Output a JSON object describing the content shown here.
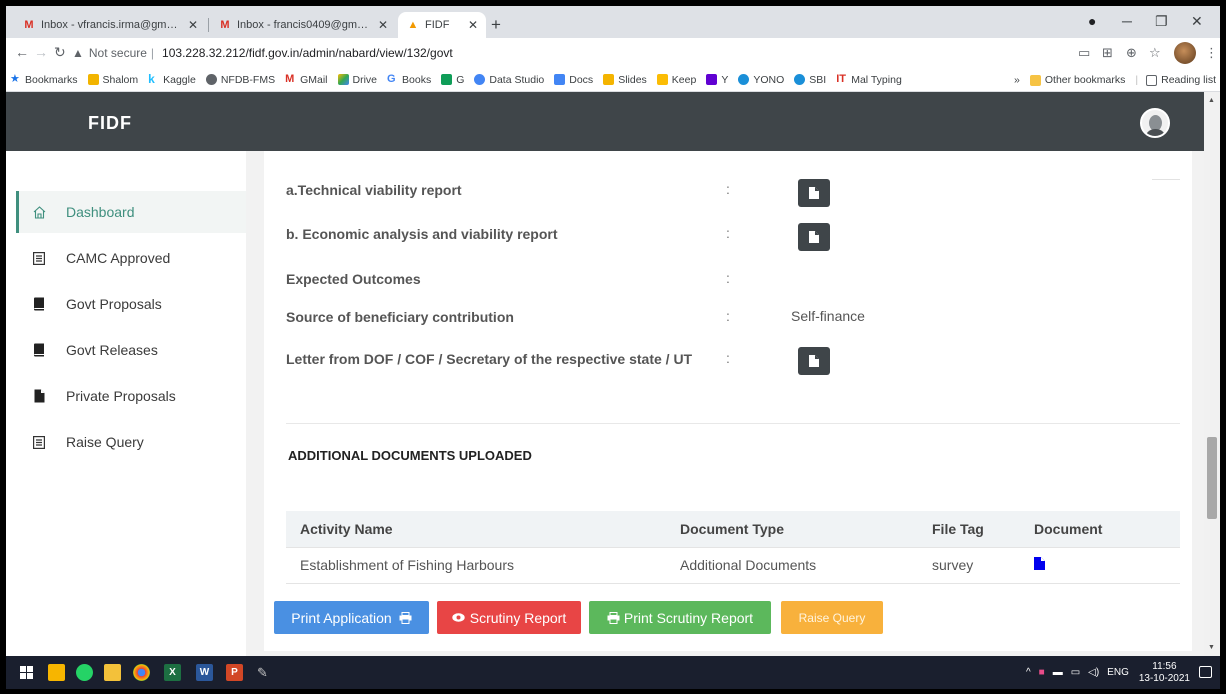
{
  "browser": {
    "tabs": [
      {
        "title": "Inbox - vfrancis.irma@gmail.com",
        "icon": "gmail-icon"
      },
      {
        "title": "Inbox - francis0409@gmail.com",
        "icon": "gmail-icon"
      },
      {
        "title": "FIDF",
        "icon": "fidf-favicon"
      }
    ],
    "security_label": "Not secure",
    "url": "103.228.32.212/fidf.gov.in/admin/nabard/view/132/govt",
    "bookmarks": [
      "Bookmarks",
      "Shalom",
      "Kaggle",
      "NFDB-FMS",
      "GMail",
      "Drive",
      "Books",
      "G",
      "Data Studio",
      "Docs",
      "Slides",
      "Keep",
      "Y",
      "YONO",
      "SBI",
      "Mal Typing"
    ],
    "bookmarks_right": {
      "more": "»",
      "other": "Other bookmarks",
      "reading": "Reading list"
    }
  },
  "app": {
    "logo": "FIDF",
    "sidebar": [
      {
        "label": "Dashboard",
        "icon": "home-icon",
        "active": true
      },
      {
        "label": "CAMC Approved",
        "icon": "list-icon"
      },
      {
        "label": "Govt Proposals",
        "icon": "book-icon"
      },
      {
        "label": "Govt Releases",
        "icon": "book-icon"
      },
      {
        "label": "Private Proposals",
        "icon": "file-icon"
      },
      {
        "label": "Raise Query",
        "icon": "list-icon"
      }
    ],
    "fields": [
      {
        "label": "a.Technical viability report",
        "colon": ":",
        "value": ""
      },
      {
        "label": "b. Economic analysis and viability report",
        "colon": ":",
        "value": ""
      },
      {
        "label": "Expected Outcomes",
        "colon": ":",
        "value": ""
      },
      {
        "label": "Source of beneficiary contribution",
        "colon": ":",
        "value": "Self-finance"
      },
      {
        "label": "Letter from DOF / COF / Secretary of the respective state / UT",
        "colon": ":",
        "value": ""
      }
    ],
    "additional_heading": "ADDITIONAL DOCUMENTS UPLOADED",
    "table": {
      "headers": [
        "Activity Name",
        "Document Type",
        "File Tag",
        "Document"
      ],
      "rows": [
        [
          "Establishment of Fishing Harbours",
          "Additional Documents",
          "survey",
          ""
        ]
      ]
    },
    "buttons": {
      "print_application": "Print Application",
      "scrutiny_report": "Scrutiny Report",
      "print_scrutiny_report": "Print Scrutiny Report",
      "raise_query": "Raise Query"
    },
    "colors": {
      "header": "#3f4549",
      "accent": "#3f8f7e",
      "print": "#4a90e2",
      "scrutiny": "#e84545",
      "print_scrutiny": "#5cb85c",
      "raise": "#f8b13c"
    }
  },
  "taskbar": {
    "language": "ENG",
    "time": "11:56",
    "date": "13-10-2021"
  }
}
